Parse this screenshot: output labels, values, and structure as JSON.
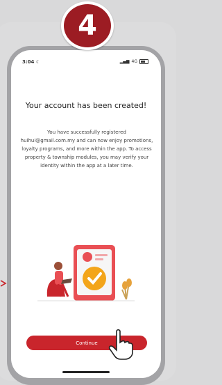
{
  "step_number": "4",
  "status_bar": {
    "time": "3:04",
    "network": "4G"
  },
  "screen": {
    "title": "Your account has been created!",
    "body": "You have successfully registered huihui@gmail.com.my and can now enjoy promotions, loyalty programs, and more within the app. To access property & township modules, you may verify your identity within the app at a later time.",
    "cta_label": "Continue"
  },
  "colors": {
    "accent": "#c9252c",
    "badge": "#9c1c23",
    "background": "#d9d9da"
  },
  "icons": [
    "moon-icon",
    "signal-icon",
    "battery-icon",
    "checkmark-badge-icon",
    "pointer-hand-icon"
  ]
}
